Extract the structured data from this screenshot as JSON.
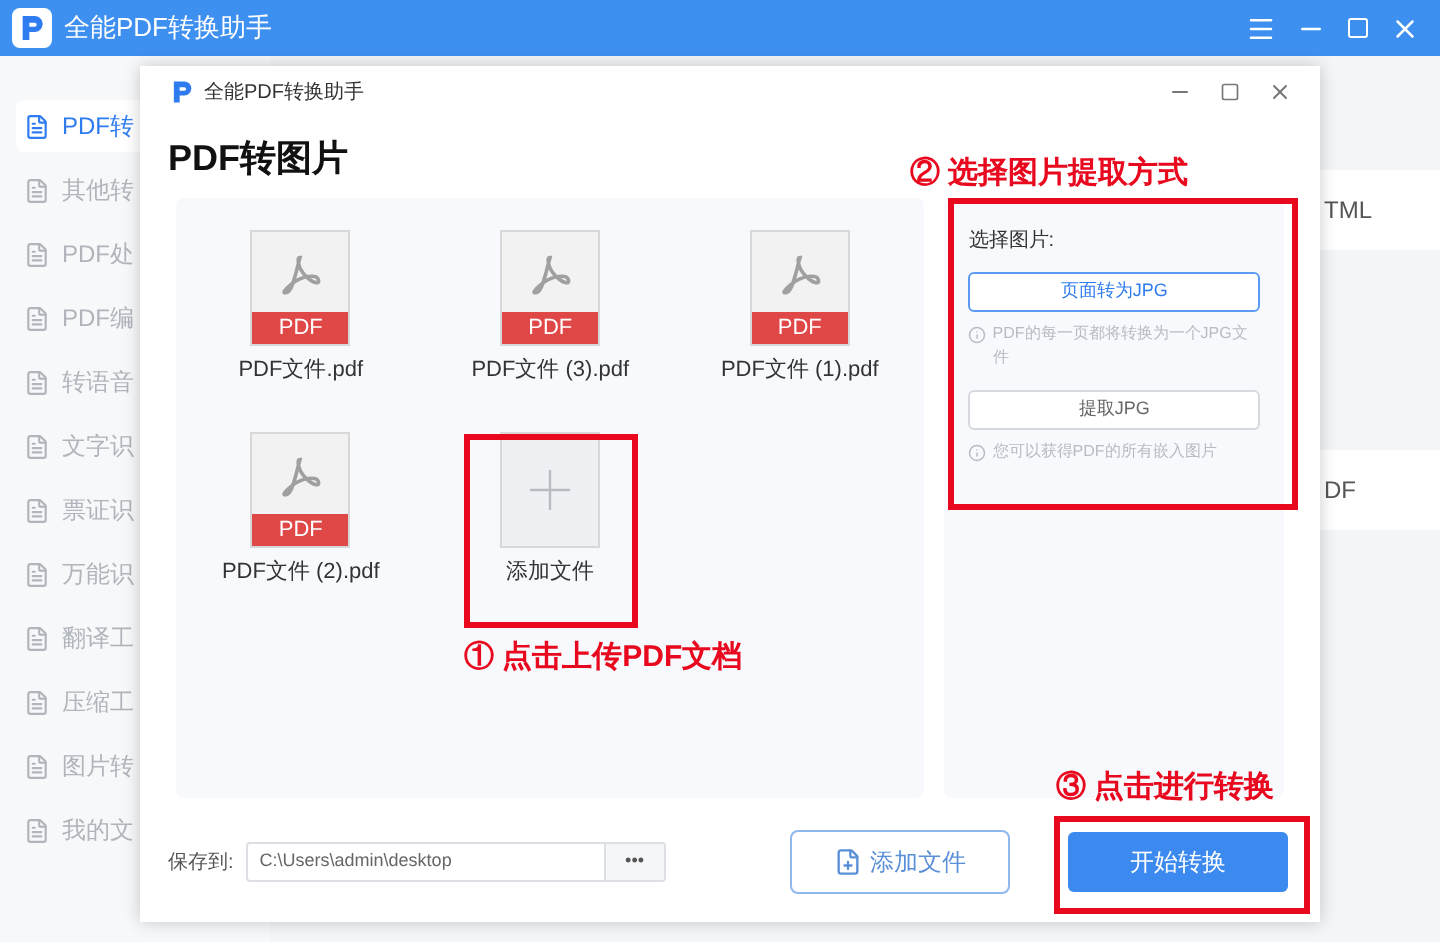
{
  "app": {
    "title": "全能PDF转换助手"
  },
  "sidebar": {
    "items": [
      {
        "label": "PDF转",
        "selected": true
      },
      {
        "label": "其他转",
        "selected": false
      },
      {
        "label": "PDF处",
        "selected": false
      },
      {
        "label": "PDF编",
        "selected": false
      },
      {
        "label": "转语音",
        "selected": false
      },
      {
        "label": "文字识",
        "selected": false
      },
      {
        "label": "票证识",
        "selected": false
      },
      {
        "label": "万能识",
        "selected": false
      },
      {
        "label": "翻译工",
        "selected": false
      },
      {
        "label": "压缩工",
        "selected": false
      },
      {
        "label": "图片转",
        "selected": false
      },
      {
        "label": "我的文",
        "selected": false
      }
    ]
  },
  "background_cards": [
    "TML",
    "DF"
  ],
  "dialog": {
    "title": "全能PDF转换助手",
    "heading": "PDF转图片",
    "files": [
      {
        "kind": "pdf",
        "name": "PDF文件.pdf",
        "badge": "PDF"
      },
      {
        "kind": "pdf",
        "name": "PDF文件 (3).pdf",
        "badge": "PDF"
      },
      {
        "kind": "pdf",
        "name": "PDF文件 (1).pdf",
        "badge": "PDF"
      },
      {
        "kind": "pdf",
        "name": "PDF文件 (2).pdf",
        "badge": "PDF"
      },
      {
        "kind": "add",
        "name": "添加文件"
      }
    ],
    "options": {
      "label": "选择图片:",
      "choices": [
        {
          "label": "页面转为JPG",
          "hint": "PDF的每一页都将转换为一个JPG文件",
          "selected": true
        },
        {
          "label": "提取JPG",
          "hint": "您可以获得PDF的所有嵌入图片",
          "selected": false
        }
      ]
    },
    "save": {
      "label": "保存到:",
      "path": "C:\\Users\\admin\\desktop",
      "browse": "•••"
    },
    "add_button": "添加文件",
    "start_button": "开始转换"
  },
  "annotations": [
    "① 点击上传PDF文档",
    "② 选择图片提取方式",
    "③ 点击进行转换"
  ]
}
